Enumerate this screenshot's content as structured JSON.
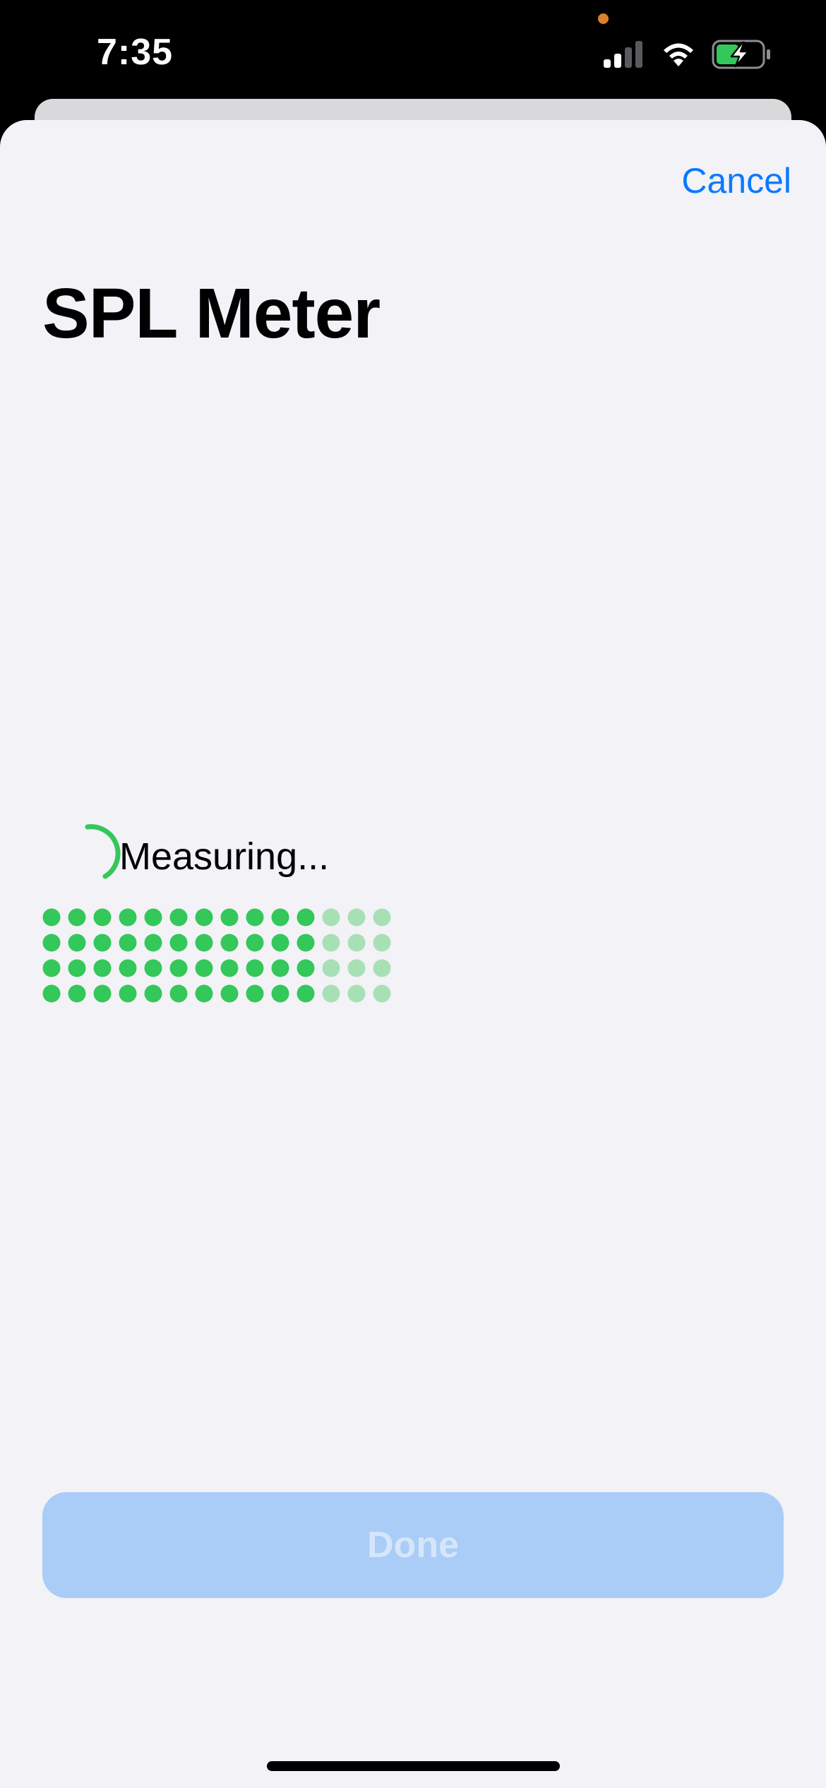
{
  "status_bar": {
    "time": "7:35",
    "signal_bars": 2,
    "signal_bars_total": 4,
    "battery_level": 0.5,
    "battery_charging": true,
    "icons": [
      "signal-icon",
      "wifi-icon",
      "battery-charging-icon"
    ]
  },
  "sheet": {
    "cancel_label": "Cancel",
    "title": "SPL Meter",
    "measuring_label": "Measuring...",
    "level_meter": {
      "rows": 4,
      "columns": 14,
      "active_columns": 11,
      "active_color": "#34c759",
      "inactive_color": "#a8e0b6"
    },
    "done_label": "Done",
    "done_enabled": false
  },
  "colors": {
    "accent": "#0a7aff",
    "spinner": "#34c759",
    "sheet_background": "#f2f2f7"
  }
}
